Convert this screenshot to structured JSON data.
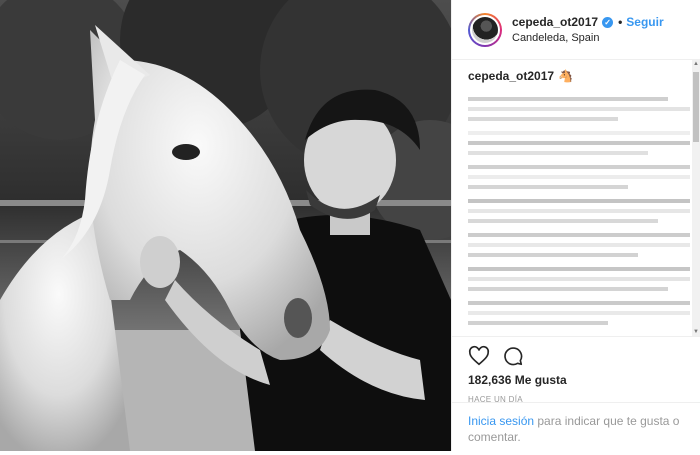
{
  "post": {
    "username": "cepeda_ot2017",
    "verified_icon": "verified-badge-icon",
    "separator": "•",
    "follow_label": "Seguir",
    "location": "Candeleda, Spain",
    "caption_user": "cepeda_ot2017",
    "caption_emoji": "🐴",
    "likes": "182,636 Me gusta",
    "timestamp": "HACE UN DÍA",
    "login_link": "Inicia sesión",
    "login_text": " para indicar que te gusta o comentar."
  },
  "icons": {
    "like": "heart-icon",
    "comment": "comment-icon"
  },
  "colors": {
    "accent": "#3897f0",
    "text": "#262626",
    "muted": "#999999"
  }
}
